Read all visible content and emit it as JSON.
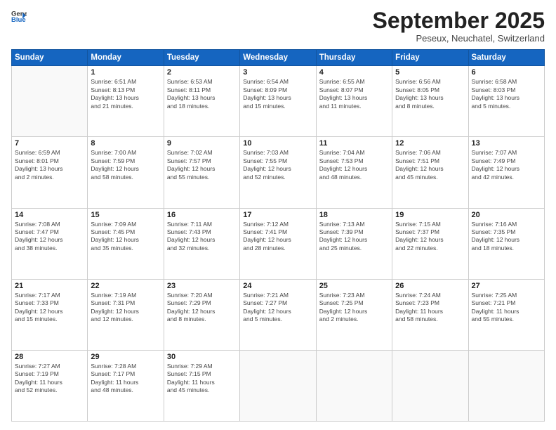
{
  "header": {
    "logo_line1": "General",
    "logo_line2": "Blue",
    "month": "September 2025",
    "location": "Peseux, Neuchatel, Switzerland"
  },
  "days_of_week": [
    "Sunday",
    "Monday",
    "Tuesday",
    "Wednesday",
    "Thursday",
    "Friday",
    "Saturday"
  ],
  "weeks": [
    [
      {
        "day": "",
        "detail": ""
      },
      {
        "day": "1",
        "detail": "Sunrise: 6:51 AM\nSunset: 8:13 PM\nDaylight: 13 hours\nand 21 minutes."
      },
      {
        "day": "2",
        "detail": "Sunrise: 6:53 AM\nSunset: 8:11 PM\nDaylight: 13 hours\nand 18 minutes."
      },
      {
        "day": "3",
        "detail": "Sunrise: 6:54 AM\nSunset: 8:09 PM\nDaylight: 13 hours\nand 15 minutes."
      },
      {
        "day": "4",
        "detail": "Sunrise: 6:55 AM\nSunset: 8:07 PM\nDaylight: 13 hours\nand 11 minutes."
      },
      {
        "day": "5",
        "detail": "Sunrise: 6:56 AM\nSunset: 8:05 PM\nDaylight: 13 hours\nand 8 minutes."
      },
      {
        "day": "6",
        "detail": "Sunrise: 6:58 AM\nSunset: 8:03 PM\nDaylight: 13 hours\nand 5 minutes."
      }
    ],
    [
      {
        "day": "7",
        "detail": "Sunrise: 6:59 AM\nSunset: 8:01 PM\nDaylight: 13 hours\nand 2 minutes."
      },
      {
        "day": "8",
        "detail": "Sunrise: 7:00 AM\nSunset: 7:59 PM\nDaylight: 12 hours\nand 58 minutes."
      },
      {
        "day": "9",
        "detail": "Sunrise: 7:02 AM\nSunset: 7:57 PM\nDaylight: 12 hours\nand 55 minutes."
      },
      {
        "day": "10",
        "detail": "Sunrise: 7:03 AM\nSunset: 7:55 PM\nDaylight: 12 hours\nand 52 minutes."
      },
      {
        "day": "11",
        "detail": "Sunrise: 7:04 AM\nSunset: 7:53 PM\nDaylight: 12 hours\nand 48 minutes."
      },
      {
        "day": "12",
        "detail": "Sunrise: 7:06 AM\nSunset: 7:51 PM\nDaylight: 12 hours\nand 45 minutes."
      },
      {
        "day": "13",
        "detail": "Sunrise: 7:07 AM\nSunset: 7:49 PM\nDaylight: 12 hours\nand 42 minutes."
      }
    ],
    [
      {
        "day": "14",
        "detail": "Sunrise: 7:08 AM\nSunset: 7:47 PM\nDaylight: 12 hours\nand 38 minutes."
      },
      {
        "day": "15",
        "detail": "Sunrise: 7:09 AM\nSunset: 7:45 PM\nDaylight: 12 hours\nand 35 minutes."
      },
      {
        "day": "16",
        "detail": "Sunrise: 7:11 AM\nSunset: 7:43 PM\nDaylight: 12 hours\nand 32 minutes."
      },
      {
        "day": "17",
        "detail": "Sunrise: 7:12 AM\nSunset: 7:41 PM\nDaylight: 12 hours\nand 28 minutes."
      },
      {
        "day": "18",
        "detail": "Sunrise: 7:13 AM\nSunset: 7:39 PM\nDaylight: 12 hours\nand 25 minutes."
      },
      {
        "day": "19",
        "detail": "Sunrise: 7:15 AM\nSunset: 7:37 PM\nDaylight: 12 hours\nand 22 minutes."
      },
      {
        "day": "20",
        "detail": "Sunrise: 7:16 AM\nSunset: 7:35 PM\nDaylight: 12 hours\nand 18 minutes."
      }
    ],
    [
      {
        "day": "21",
        "detail": "Sunrise: 7:17 AM\nSunset: 7:33 PM\nDaylight: 12 hours\nand 15 minutes."
      },
      {
        "day": "22",
        "detail": "Sunrise: 7:19 AM\nSunset: 7:31 PM\nDaylight: 12 hours\nand 12 minutes."
      },
      {
        "day": "23",
        "detail": "Sunrise: 7:20 AM\nSunset: 7:29 PM\nDaylight: 12 hours\nand 8 minutes."
      },
      {
        "day": "24",
        "detail": "Sunrise: 7:21 AM\nSunset: 7:27 PM\nDaylight: 12 hours\nand 5 minutes."
      },
      {
        "day": "25",
        "detail": "Sunrise: 7:23 AM\nSunset: 7:25 PM\nDaylight: 12 hours\nand 2 minutes."
      },
      {
        "day": "26",
        "detail": "Sunrise: 7:24 AM\nSunset: 7:23 PM\nDaylight: 11 hours\nand 58 minutes."
      },
      {
        "day": "27",
        "detail": "Sunrise: 7:25 AM\nSunset: 7:21 PM\nDaylight: 11 hours\nand 55 minutes."
      }
    ],
    [
      {
        "day": "28",
        "detail": "Sunrise: 7:27 AM\nSunset: 7:19 PM\nDaylight: 11 hours\nand 52 minutes."
      },
      {
        "day": "29",
        "detail": "Sunrise: 7:28 AM\nSunset: 7:17 PM\nDaylight: 11 hours\nand 48 minutes."
      },
      {
        "day": "30",
        "detail": "Sunrise: 7:29 AM\nSunset: 7:15 PM\nDaylight: 11 hours\nand 45 minutes."
      },
      {
        "day": "",
        "detail": ""
      },
      {
        "day": "",
        "detail": ""
      },
      {
        "day": "",
        "detail": ""
      },
      {
        "day": "",
        "detail": ""
      }
    ]
  ]
}
